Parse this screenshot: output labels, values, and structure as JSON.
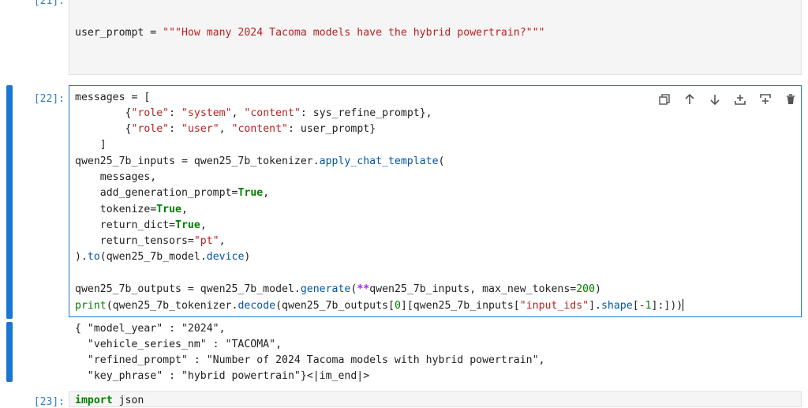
{
  "cells": [
    {
      "prompt": "[21]:",
      "code": "user_prompt = \"\"\"How many 2024 Tacoma models have the hybrid powertrain?\"\"\""
    },
    {
      "prompt": "[22]:",
      "lines": [
        "messages = [",
        "        {\"role\": \"system\", \"content\": sys_refine_prompt},",
        "        {\"role\": \"user\", \"content\": user_prompt}",
        "    ]",
        "qwen25_7b_inputs = qwen25_7b_tokenizer.apply_chat_template(",
        "    messages,",
        "    add_generation_prompt=True,",
        "    tokenize=True,",
        "    return_dict=True,",
        "    return_tensors=\"pt\",",
        ").to(qwen25_7b_model.device)",
        "",
        "qwen25_7b_outputs = qwen25_7b_model.generate(**qwen25_7b_inputs, max_new_tokens=200)",
        "print(qwen25_7b_tokenizer.decode(qwen25_7b_outputs[0][qwen25_7b_inputs[\"input_ids\"].shape[-1]:]))"
      ],
      "output": [
        "{ \"model_year\" : \"2024\",",
        "  \"vehicle_series_nm\" : \"TACOMA\",",
        "  \"refined_prompt\" : \"Number of 2024 Tacoma models with hybrid powertrain\",",
        "  \"key_phrase\" : \"hybrid powertrain\"}<|im_end|>"
      ]
    },
    {
      "prompt": "[23]:",
      "code": "import json"
    }
  ],
  "toolbar": {
    "icons": [
      "duplicate-icon",
      "move-up-icon",
      "move-down-icon",
      "insert-above-icon",
      "insert-below-icon",
      "delete-icon"
    ]
  },
  "colors": {
    "active_bar": "#1976d2",
    "prompt": "#307fc1",
    "keyword": "#008000",
    "string": "#ba2121",
    "builtin_fn": "#0055aa"
  }
}
